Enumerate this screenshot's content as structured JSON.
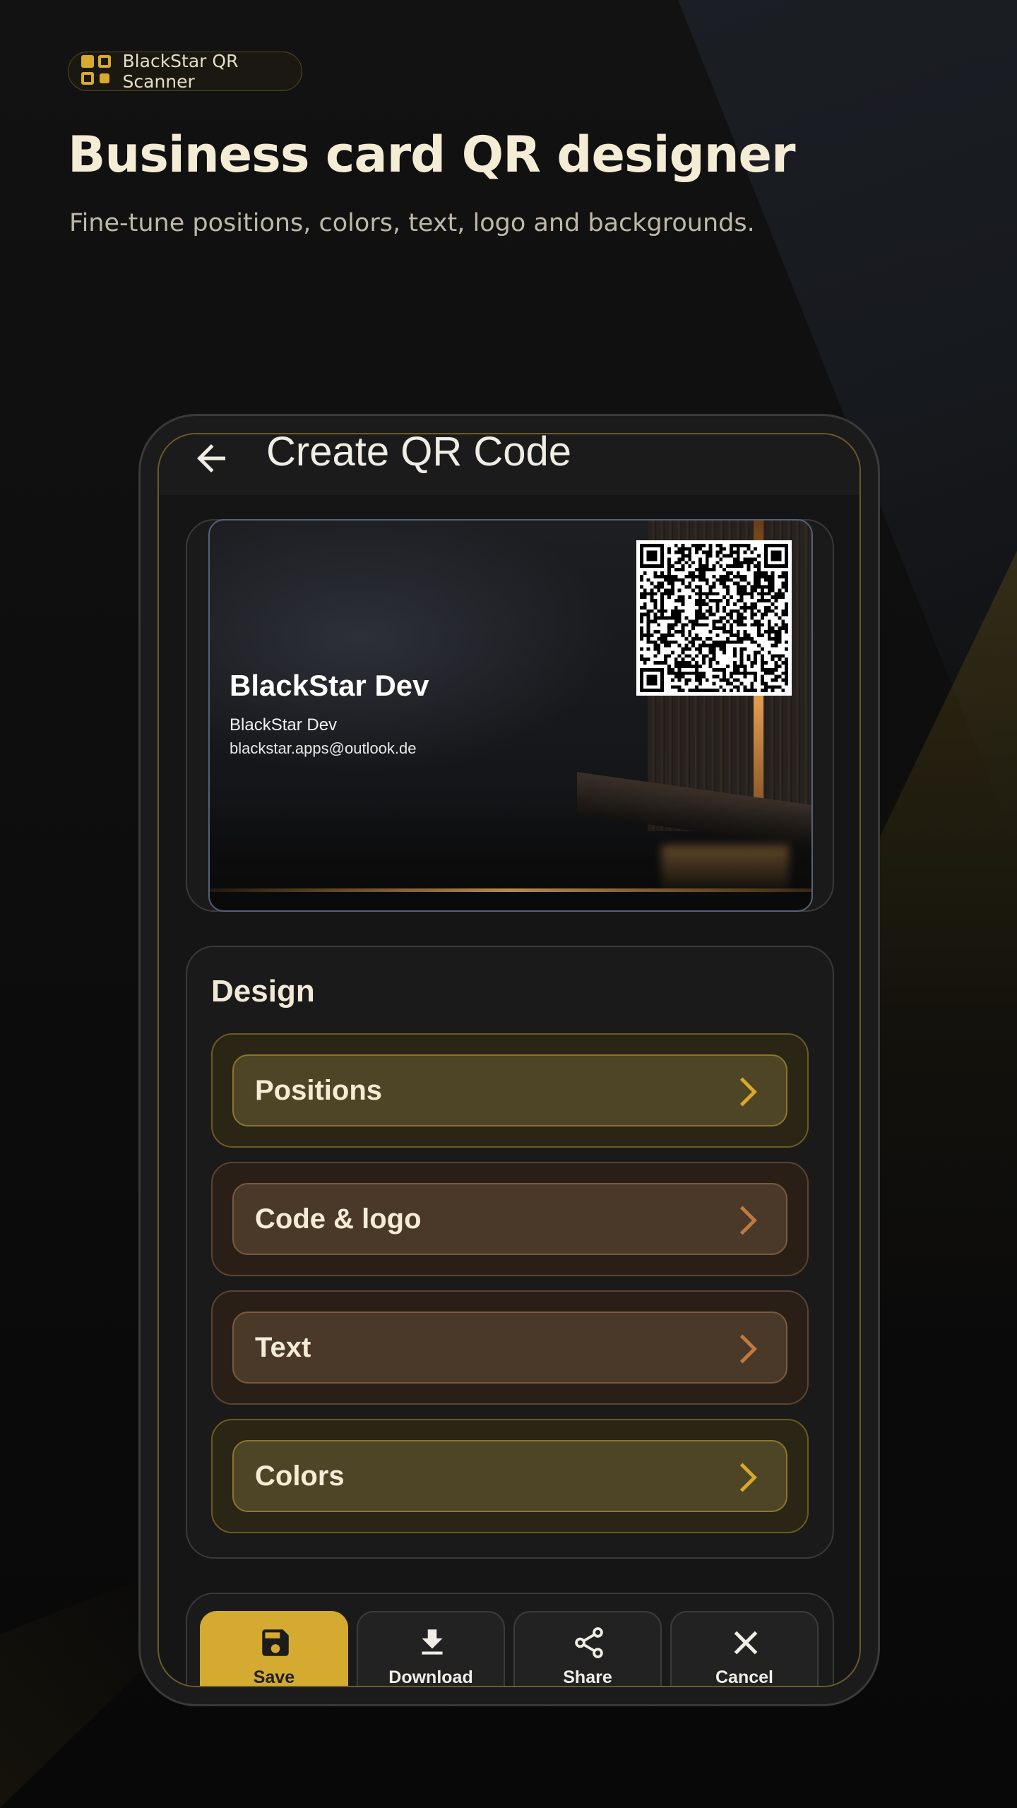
{
  "badge": {
    "label": "BlackStar QR Scanner",
    "icon": "qr-grid-icon"
  },
  "hero": {
    "title": "Business card QR designer",
    "subtitle": "Fine-tune positions, colors, text, logo and backgrounds."
  },
  "appbar": {
    "title": "Create QR Code",
    "back_icon": "arrow-left-icon"
  },
  "card": {
    "name": "BlackStar Dev",
    "company": "BlackStar Dev",
    "email": "blackstar.apps@outlook.de"
  },
  "design": {
    "title": "Design",
    "options": [
      {
        "label": "Positions",
        "style": "yellow",
        "icon": "chevron-right-icon"
      },
      {
        "label": "Code & logo",
        "style": "brown",
        "icon": "chevron-right-icon"
      },
      {
        "label": "Text",
        "style": "brown",
        "icon": "chevron-right-icon"
      },
      {
        "label": "Colors",
        "style": "yellow",
        "icon": "chevron-right-icon"
      }
    ]
  },
  "actions": [
    {
      "label": "Save",
      "icon": "save-icon",
      "primary": true
    },
    {
      "label": "Download",
      "icon": "download-icon",
      "primary": false
    },
    {
      "label": "Share",
      "icon": "share-icon",
      "primary": false
    },
    {
      "label": "Cancel",
      "icon": "close-icon",
      "primary": false
    }
  ],
  "colors": {
    "accent": "#d4aa30",
    "background": "#0f0f0f",
    "panel": "#1a1a1a",
    "text": "#f1e9d6"
  }
}
